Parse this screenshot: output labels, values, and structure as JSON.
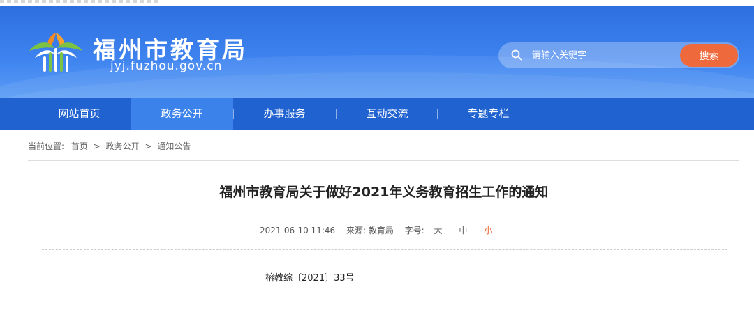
{
  "header": {
    "site_name": "福州市教育局",
    "site_domain": "jyj.fuzhou.gov.cn",
    "logo_icon": "banyan-leaf-logo-icon"
  },
  "search": {
    "placeholder": "请输入关键字",
    "button_label": "搜索",
    "icon": "search-icon"
  },
  "nav": {
    "items": [
      {
        "label": "网站首页"
      },
      {
        "label": "政务公开",
        "active": true
      },
      {
        "label": "办事服务"
      },
      {
        "label": "互动交流"
      },
      {
        "label": "专题专栏"
      }
    ]
  },
  "breadcrumb": {
    "prefix": "当前位置:",
    "items": [
      "首页",
      "政务公开",
      "通知公告"
    ],
    "separator": ">"
  },
  "article": {
    "title": "福州市教育局关于做好2021年义务教育招生工作的通知",
    "datetime": "2021-06-10 11:46",
    "source": "来源: 教育局",
    "font_size_label": "字号:",
    "font_size_options": [
      "大",
      "中",
      "小"
    ],
    "font_size_selected": "小",
    "doc_number": "榕教综〔2021〕33号"
  },
  "colors": {
    "header_blue": "#3d82ef",
    "nav_blue": "#1f62d0",
    "nav_active": "#3b82ea",
    "search_button": "#ee6a3d",
    "font_size_active": "#e8632e",
    "logo_green": "#7cc243",
    "logo_orange": "#f08a24"
  }
}
